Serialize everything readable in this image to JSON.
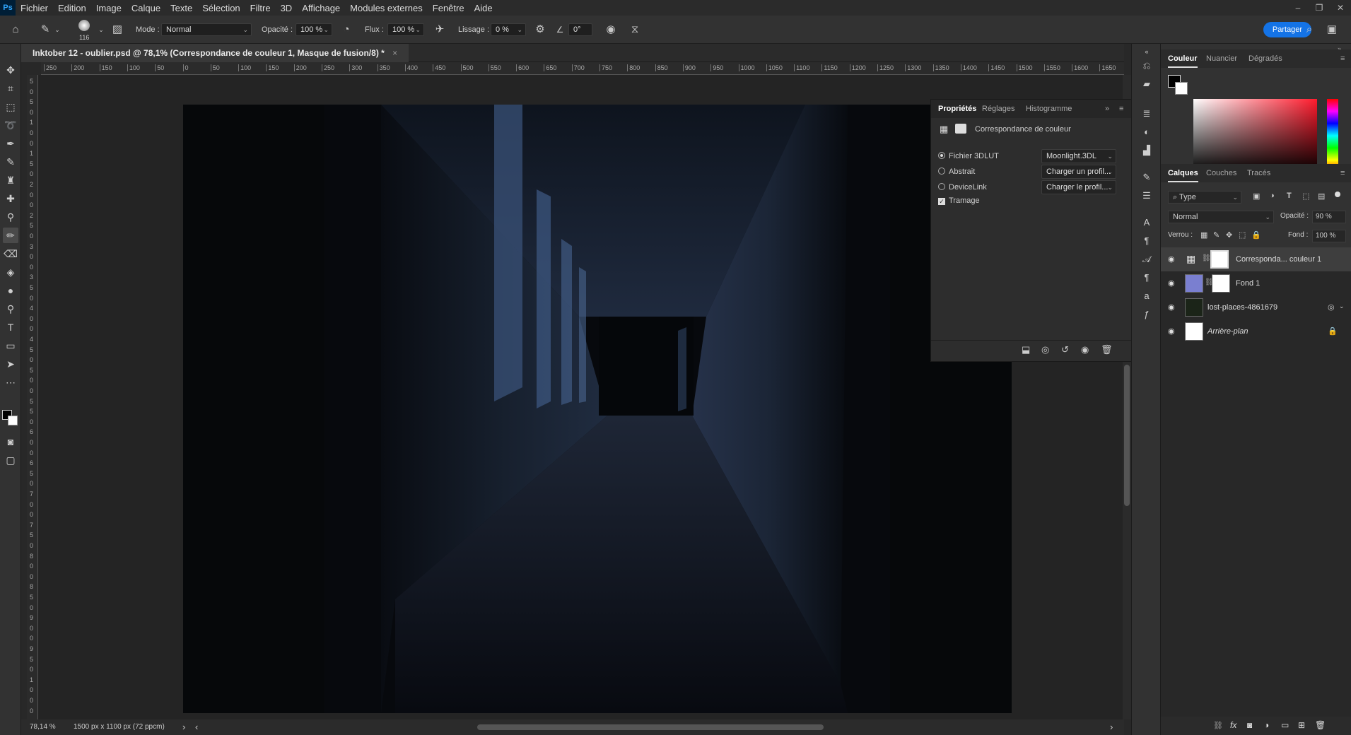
{
  "menu": {
    "logo": "Ps",
    "items": [
      "Fichier",
      "Edition",
      "Image",
      "Calque",
      "Texte",
      "Sélection",
      "Filtre",
      "3D",
      "Affichage",
      "Modules externes",
      "Fenêtre",
      "Aide"
    ]
  },
  "window_controls": [
    "–",
    "❐",
    "✕"
  ],
  "options": {
    "brush_size": "116",
    "mode_label": "Mode :",
    "mode_value": "Normal",
    "opacity_label": "Opacité :",
    "opacity_value": "100 %",
    "flux_label": "Flux :",
    "flux_value": "100 %",
    "smoothing_label": "Lissage :",
    "smoothing_value": "0 %",
    "angle_value": "0°",
    "share_label": "Partager"
  },
  "document": {
    "tab_title": "Inktober 12 - oublier.psd @ 78,1% (Correspondance de couleur 1, Masque de fusion/8) *",
    "close": "×"
  },
  "ruler": {
    "h_labels": [
      "250",
      "200",
      "150",
      "100",
      "50",
      "0",
      "50",
      "100",
      "150",
      "200",
      "250",
      "300",
      "350",
      "400",
      "450",
      "500",
      "550",
      "600",
      "650",
      "700",
      "750",
      "800",
      "850",
      "900",
      "950",
      "1000",
      "1050",
      "1100",
      "1150",
      "1200",
      "1250",
      "1300",
      "1350",
      "1400",
      "1450",
      "1500",
      "1550",
      "1600",
      "1650"
    ],
    "v_labels": [
      "5",
      "0",
      "5",
      "0",
      "1",
      "0",
      "0",
      "1",
      "5",
      "0",
      "2",
      "0",
      "0",
      "2",
      "5",
      "0",
      "3",
      "0",
      "0",
      "3",
      "5",
      "0",
      "4",
      "0",
      "0",
      "4",
      "5",
      "0",
      "5",
      "0",
      "0",
      "5",
      "5",
      "0",
      "6",
      "0",
      "0",
      "6",
      "5",
      "0",
      "7",
      "0",
      "0",
      "7",
      "5",
      "0",
      "8",
      "0",
      "0",
      "8",
      "5",
      "0",
      "9",
      "0",
      "0",
      "9",
      "5",
      "0",
      "1",
      "0",
      "0",
      "0"
    ]
  },
  "status": {
    "zoom": "78,14 %",
    "info": "1500 px x 1100 px (72 ppcm)",
    "arrow": "›",
    "scroll_left": "‹",
    "scroll_right": "›"
  },
  "properties": {
    "tabs": [
      "Propriétés",
      "Réglages",
      "Histogramme"
    ],
    "header": "Correspondance de couleur",
    "options": [
      {
        "label": "Fichier 3DLUT",
        "selected": true,
        "dropdown": "Moonlight.3DL"
      },
      {
        "label": "Abstrait",
        "selected": false,
        "dropdown": "Charger un profil..."
      },
      {
        "label": "DeviceLink",
        "selected": false,
        "dropdown": "Charger le profil..."
      }
    ],
    "dither_label": "Tramage",
    "dither_checked": true
  },
  "color_panel": {
    "tabs": [
      "Couleur",
      "Nuancier",
      "Dégradés"
    ],
    "foreground": "#000000",
    "background": "#ffffff"
  },
  "layers_panel": {
    "tabs": [
      "Calques",
      "Couches",
      "Tracés"
    ],
    "filter_value": "Type",
    "blend_mode": "Normal",
    "opacity_label": "Opacité :",
    "opacity_value": "90 %",
    "lock_label": "Verrou :",
    "fill_label": "Fond :",
    "fill_value": "100 %",
    "layers": [
      {
        "name": "Correspondа... couleur 1",
        "selected": true
      },
      {
        "name": "Fond 1",
        "selected": false
      },
      {
        "name": "lost-places-4861679",
        "selected": false
      },
      {
        "name": "Arrière-plan",
        "selected": false
      }
    ]
  },
  "colors": {
    "accent": "#1473e6",
    "fond1_thumb": "#7a7fd0"
  }
}
